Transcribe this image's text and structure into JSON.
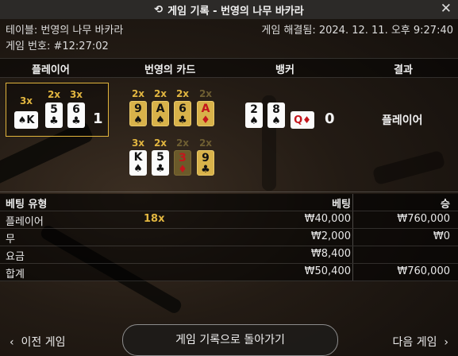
{
  "title": "게임 기록 - 번영의 나무 바카라",
  "info": {
    "table_label": "테이블: 번영의 나무 바카라",
    "game_no_label": "게임 번호: #12:27:02",
    "resolved_label": "게임 해결됨: 2024. 12. 11. 오후 9:27:40"
  },
  "columns": {
    "player": "플레이어",
    "cards": "번영의 카드",
    "banker": "뱅커",
    "result": "결과"
  },
  "player_hand": {
    "multipliers": [
      "3x",
      "2x",
      "3x"
    ],
    "cards": [
      {
        "rank": "K",
        "suit": "♠",
        "color": "black"
      },
      {
        "rank": "5",
        "suit": "♣",
        "color": "black"
      },
      {
        "rank": "6",
        "suit": "♣",
        "color": "black"
      }
    ],
    "score": "1"
  },
  "prosperity_cards": {
    "row1": {
      "multipliers": [
        "2x",
        "2x",
        "2x",
        "2x"
      ],
      "cards": [
        {
          "rank": "9",
          "suit": "♠",
          "color": "black"
        },
        {
          "rank": "A",
          "suit": "♠",
          "color": "black"
        },
        {
          "rank": "6",
          "suit": "♣",
          "color": "black"
        },
        {
          "rank": "A",
          "suit": "♦",
          "color": "red"
        }
      ]
    },
    "row2": {
      "multipliers": [
        "3x",
        "2x",
        "2x",
        "2x"
      ],
      "cards": [
        {
          "rank": "K",
          "suit": "♠",
          "color": "black"
        },
        {
          "rank": "5",
          "suit": "♣",
          "color": "black"
        },
        {
          "rank": "3",
          "suit": "♦",
          "color": "red"
        },
        {
          "rank": "9",
          "suit": "♣",
          "color": "black"
        }
      ]
    }
  },
  "banker_hand": {
    "cards": [
      {
        "rank": "2",
        "suit": "♠",
        "color": "black"
      },
      {
        "rank": "8",
        "suit": "♠",
        "color": "black"
      },
      {
        "rank": "Q",
        "suit": "♦",
        "color": "red"
      }
    ],
    "score": "0"
  },
  "result": "플레이어",
  "bets": {
    "headers": {
      "type": "베팅 유형",
      "bet": "베팅",
      "win": "승"
    },
    "rows": [
      {
        "name": "플레이어",
        "mult": "18x",
        "bet": "₩40,000",
        "win": "₩760,000"
      },
      {
        "name": "무",
        "mult": "",
        "bet": "₩2,000",
        "win": "₩0"
      },
      {
        "name": "요금",
        "mult": "",
        "bet": "₩8,400",
        "win": ""
      },
      {
        "name": "합계",
        "mult": "",
        "bet": "₩50,400",
        "win": "₩760,000"
      }
    ]
  },
  "footer": {
    "prev": "이전 게임",
    "back": "게임 기록으로 돌아가기",
    "next": "다음 게임"
  },
  "colors": {
    "gold": "#e2b640",
    "red_suit": "#c4161c"
  }
}
